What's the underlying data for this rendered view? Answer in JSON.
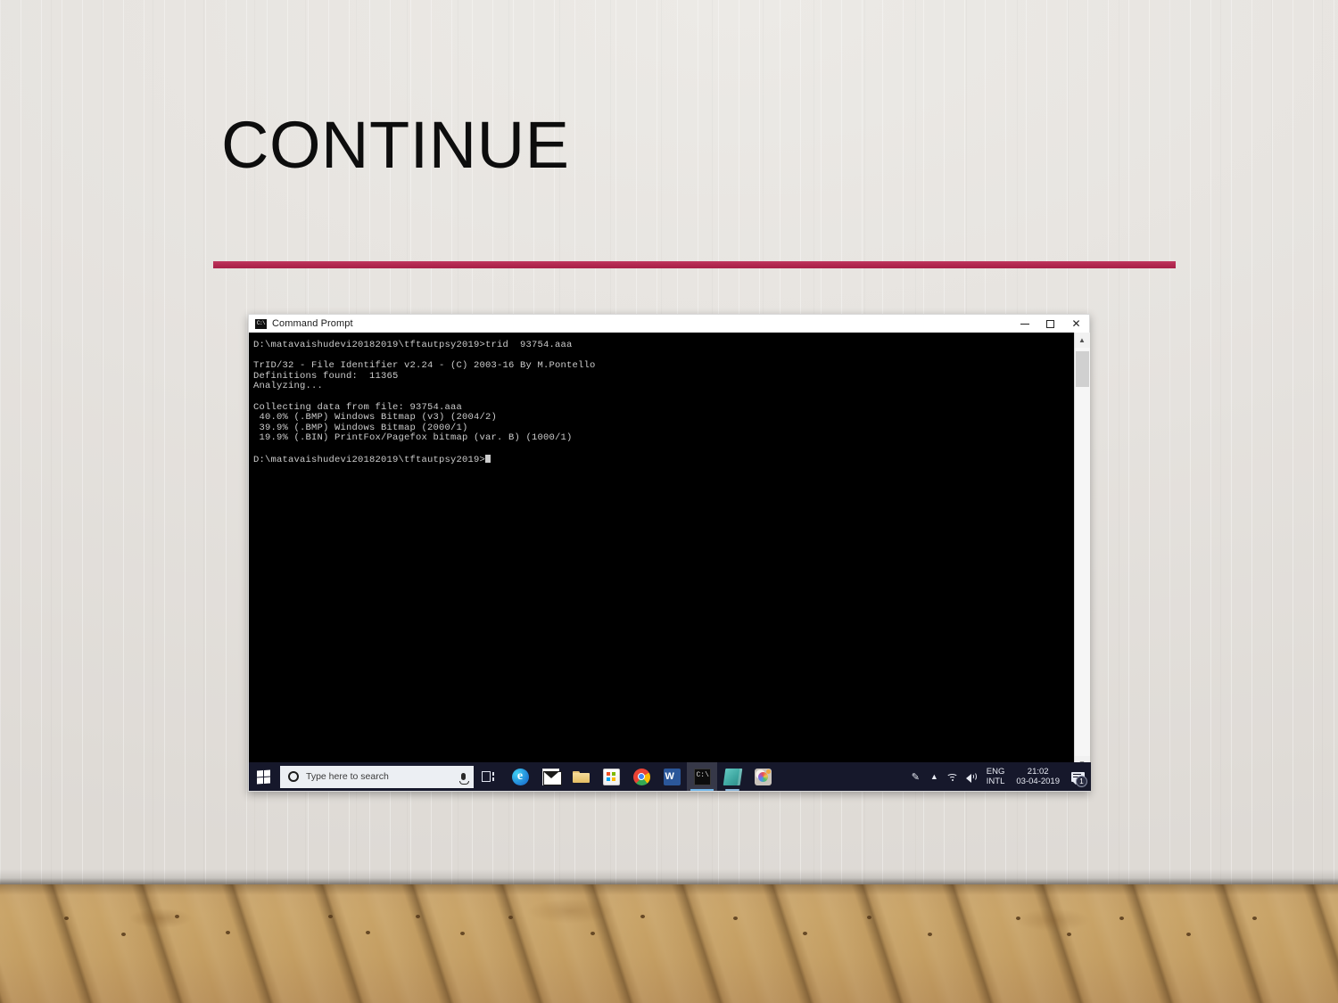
{
  "slide": {
    "title": "CONTINUE",
    "accent_color": "#b42a52",
    "wall_color": "#e6e3df",
    "floor_color": "#c49e62"
  },
  "cmd_window": {
    "title": "Command Prompt",
    "icon": "command-prompt-icon",
    "icon_label": "C:\\",
    "window_controls": {
      "minimize": "–",
      "maximize": "❐",
      "close": "✕"
    },
    "console_lines": [
      "D:\\matavaishudevi20182019\\tftautpsy2019>trid  93754.aaa",
      "",
      "TrID/32 - File Identifier v2.24 - (C) 2003-16 By M.Pontello",
      "Definitions found:  11365",
      "Analyzing...",
      "",
      "Collecting data from file: 93754.aaa",
      " 40.0% (.BMP) Windows Bitmap (v3) (2004/2)",
      " 39.9% (.BMP) Windows Bitmap (2000/1)",
      " 19.9% (.BIN) PrintFox/Pagefox bitmap (var. B) (1000/1)",
      "",
      "D:\\matavaishudevi20182019\\tftautpsy2019>"
    ],
    "console_text": "D:\\matavaishudevi20182019\\tftautpsy2019>trid  93754.aaa\n\nTrID/32 - File Identifier v2.24 - (C) 2003-16 By M.Pontello\nDefinitions found:  11365\nAnalyzing...\n\nCollecting data from file: 93754.aaa\n 40.0% (.BMP) Windows Bitmap (v3) (2004/2)\n 39.9% (.BMP) Windows Bitmap (2000/1)\n 19.9% (.BIN) PrintFox/Pagefox bitmap (var. B) (1000/1)\n\nD:\\matavaishudevi20182019\\tftautpsy2019>",
    "scrollbar": {
      "up_arrow": "▲",
      "down_arrow": "▼"
    }
  },
  "taskbar": {
    "start_button": "start-button",
    "search": {
      "placeholder": "Type here to search",
      "cortana_icon": "cortana-circle-icon",
      "mic_icon": "microphone-icon"
    },
    "task_view": "task-view-icon",
    "apps": [
      {
        "name": "microsoft-edge",
        "label": "e",
        "state": "pinned"
      },
      {
        "name": "mail",
        "label": "",
        "state": "pinned"
      },
      {
        "name": "file-explorer",
        "label": "",
        "state": "pinned"
      },
      {
        "name": "microsoft-store",
        "label": "",
        "state": "pinned"
      },
      {
        "name": "google-chrome",
        "label": "",
        "state": "pinned"
      },
      {
        "name": "microsoft-word",
        "label": "W",
        "state": "pinned"
      },
      {
        "name": "command-prompt",
        "label": "C:\\",
        "state": "active"
      },
      {
        "name": "teal-app",
        "label": "",
        "state": "running"
      },
      {
        "name": "paint-3d",
        "label": "",
        "state": "pinned"
      }
    ],
    "systray": {
      "pen_icon": "pen-input-icon",
      "chevron_icon": "show-hidden-icons-chevron",
      "network_icon": "wifi-icon",
      "volume_icon": "volume-icon",
      "language_line1": "ENG",
      "language_line2": "INTL",
      "time": "21:02",
      "date": "03-04-2019",
      "notifications_icon": "action-center-icon",
      "notifications_count": "1"
    }
  }
}
